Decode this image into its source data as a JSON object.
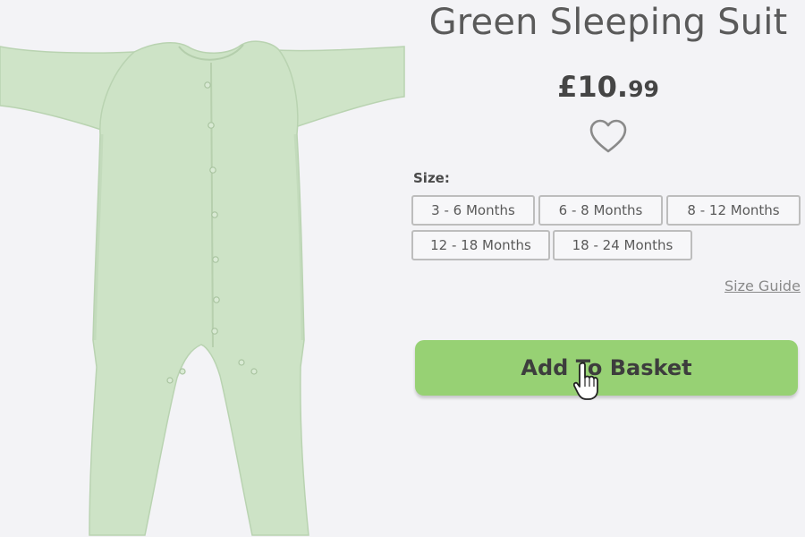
{
  "product": {
    "title": "Green Sleeping Suit",
    "price_main": "£10.",
    "price_pence": "99",
    "image_icon": "green-sleepsuit-image"
  },
  "wishlist": {
    "icon": "heart-outline-icon"
  },
  "size": {
    "label": "Size:",
    "options": [
      "3 - 6 Months",
      "6 - 8 Months",
      "8 - 12 Months",
      "12 - 18 Months",
      "18 - 24 Months"
    ],
    "guide_label": "Size Guide"
  },
  "basket": {
    "label": "Add To Basket"
  },
  "colors": {
    "background": "#f3f3f6",
    "garment": "#cde3c6",
    "button": "#97d174",
    "text": "#4a4a4a"
  }
}
